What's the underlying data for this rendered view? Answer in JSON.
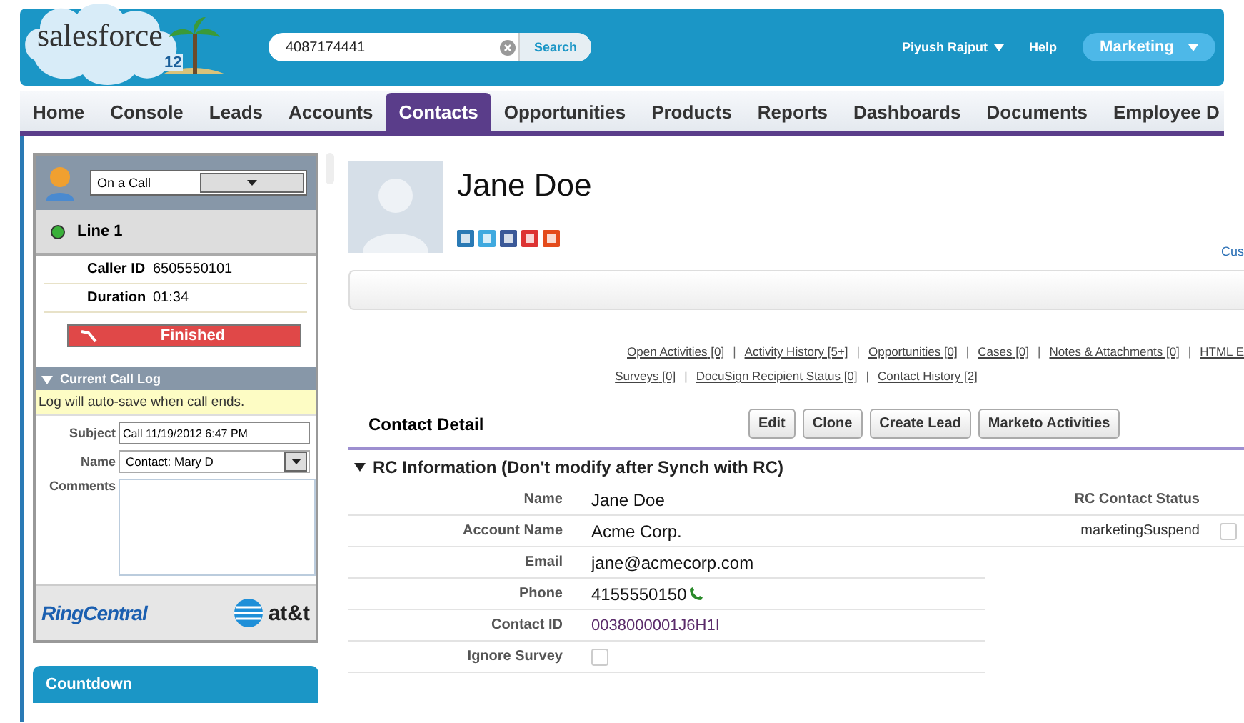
{
  "header": {
    "logo_text": "salesforce",
    "logo_badge": "12",
    "search": {
      "value": "4087174441",
      "button": "Search"
    },
    "user_menu": "Piyush Rajput",
    "help": "Help",
    "app_menu": "Marketing"
  },
  "tabs": [
    {
      "label": "Home",
      "selected": false
    },
    {
      "label": "Console",
      "selected": false
    },
    {
      "label": "Leads",
      "selected": false
    },
    {
      "label": "Accounts",
      "selected": false
    },
    {
      "label": "Contacts",
      "selected": true
    },
    {
      "label": "Opportunities",
      "selected": false
    },
    {
      "label": "Products",
      "selected": false
    },
    {
      "label": "Reports",
      "selected": false
    },
    {
      "label": "Dashboards",
      "selected": false
    },
    {
      "label": "Documents",
      "selected": false
    },
    {
      "label": "Employee D",
      "selected": false
    }
  ],
  "softphone": {
    "status": "On a Call",
    "line": "Line 1",
    "line_active": true,
    "details": [
      {
        "label": "Caller ID",
        "value": "6505550101"
      },
      {
        "label": "Duration",
        "value": "01:34"
      }
    ],
    "end_button": "Finished",
    "call_log": {
      "title": "Current Call Log",
      "expanded": true,
      "notice": "Log will auto-save when call ends.",
      "subject_label": "Subject",
      "subject": "Call 11/19/2012 6:47 PM",
      "name_label": "Name",
      "name": "Contact: Mary D",
      "comments_label": "Comments"
    },
    "brand": "RingCentral",
    "partner": "at&t"
  },
  "countdown": "Countdown",
  "contact": {
    "name": "Jane Doe",
    "customize_link": "Cus",
    "related_links": [
      [
        {
          "label": "Open Activities",
          "count": "[0]"
        },
        {
          "separator": "|",
          "label": "Activity History",
          "count": "[5+]"
        },
        {
          "separator": "|",
          "label": "Opportunities",
          "count": "[0]"
        },
        {
          "separator": "|",
          "label": "Cases",
          "count": "[0]"
        },
        {
          "separator": "|",
          "label": "Notes & Attachments",
          "count": "[0]"
        },
        {
          "separator": "|",
          "label": "HTML E"
        }
      ],
      [
        {
          "label": "Surveys",
          "count": "[0]"
        },
        {
          "separator": "|",
          "label": "DocuSign Recipient Status",
          "count": "[0]"
        },
        {
          "separator": "|",
          "label": "Contact History",
          "count": "[2]"
        }
      ]
    ],
    "detail_title": "Contact Detail",
    "buttons": [
      "Edit",
      "Clone",
      "Create Lead",
      "Marketo Activities"
    ],
    "section": {
      "title": "RC Information (Don't modify after Synch with RC)",
      "expanded": true
    },
    "fields": [
      {
        "label": "Name",
        "kind": "text",
        "value": "Jane Doe"
      },
      {
        "label": "Account Name",
        "kind": "text",
        "value": "Acme Corp."
      },
      {
        "label": "Email",
        "kind": "text",
        "value": "jane@acmecorp.com"
      },
      {
        "label": "Phone",
        "kind": "phone",
        "value": "4155550150"
      },
      {
        "label": "Contact ID",
        "kind": "id",
        "value": "0038000001J6H1I"
      },
      {
        "label": "Ignore Survey",
        "kind": "checkbox",
        "checked": false
      }
    ],
    "side_fields": [
      {
        "label": "RC Contact Status",
        "kind": "text"
      },
      {
        "label": "marketingSuspend",
        "kind": "checkbox",
        "checked": false
      }
    ]
  }
}
